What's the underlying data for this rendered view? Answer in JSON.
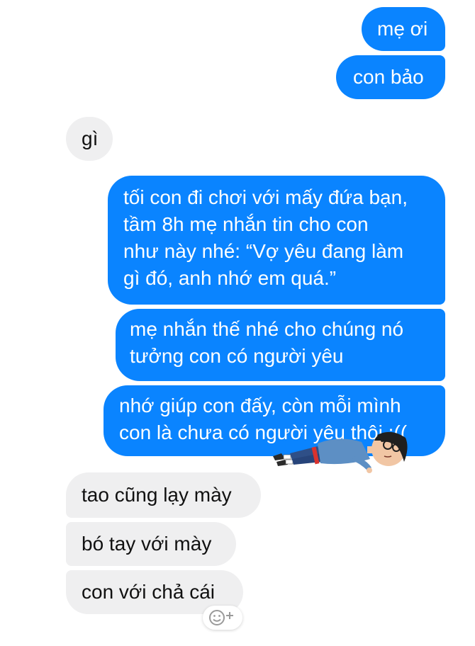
{
  "conversation": {
    "messages": [
      {
        "sender": "me",
        "lines": [
          "mẹ ơi"
        ]
      },
      {
        "sender": "me",
        "lines": [
          "con bảo"
        ]
      },
      {
        "sender": "other",
        "lines": [
          "gì"
        ]
      },
      {
        "sender": "me",
        "lines": [
          "tối con đi chơi với mấy đứa bạn,",
          "tầm 8h mẹ nhắn tin cho con",
          "như này nhé: “Vợ yêu đang làm",
          "gì đó, anh nhớ em quá.”"
        ]
      },
      {
        "sender": "me",
        "lines": [
          "mẹ nhắn thế nhé cho chúng nó",
          "tưởng con có người yêu"
        ]
      },
      {
        "sender": "me",
        "lines": [
          "nhớ giúp con đấy, còn mỗi mình",
          "con là chưa có người yêu thôi :(("
        ]
      },
      {
        "sender": "other",
        "lines": [
          "tao cũng lạy mày"
        ]
      },
      {
        "sender": "other",
        "lines": [
          "bó tay với mày"
        ]
      },
      {
        "sender": "other",
        "lines": [
          "con với chả cái"
        ]
      }
    ]
  },
  "colors": {
    "outgoing_bubble": "#0a84ff",
    "incoming_bubble": "#efeff0"
  },
  "icons": {
    "sticker": "cartoon-person-lying-sticker",
    "reaction": "add-reaction-smiley-icon"
  }
}
